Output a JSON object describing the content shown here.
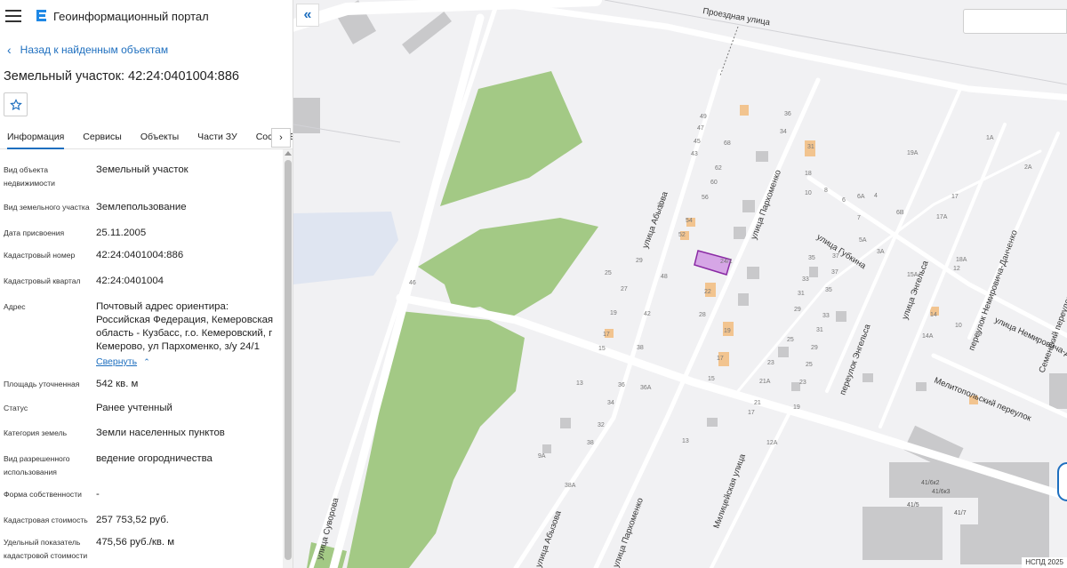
{
  "app": {
    "title": "Геоинформационный портал"
  },
  "nav": {
    "back_label": "Назад к найденным объектам"
  },
  "object": {
    "title": "Земельный участок: 42:24:0401004:886"
  },
  "tabs": [
    {
      "label": "Информация",
      "active": true
    },
    {
      "label": "Сервисы"
    },
    {
      "label": "Объекты"
    },
    {
      "label": "Части ЗУ"
    },
    {
      "label": "Состав ЕЗП"
    }
  ],
  "properties": [
    {
      "label": "Вид объекта недвижимости",
      "value": "Земельный участок"
    },
    {
      "label": "Вид земельного участка",
      "value": "Землепользование"
    },
    {
      "label": "Дата присвоения",
      "value": "25.11.2005"
    },
    {
      "label": "Кадастровый номер",
      "value": "42:24:0401004:886"
    },
    {
      "label": "Кадастровый квартал",
      "value": "42:24:0401004"
    },
    {
      "label": "Адрес",
      "value": "Почтовый адрес ориентира: Российская Федерация, Кемеровская область - Кузбасс, г.о. Кемеровский, г Кемерово, ул Пархоменко, з/у 24/1"
    },
    {
      "label": "Площадь уточненная",
      "value": "542 кв. м"
    },
    {
      "label": "Статус",
      "value": "Ранее учтенный"
    },
    {
      "label": "Категория земель",
      "value": "Земли населенных пунктов"
    },
    {
      "label": "Вид разрешенного использования",
      "value": "ведение огородничества"
    },
    {
      "label": "Форма собственности",
      "value": "-"
    },
    {
      "label": "Кадастровая стоимость",
      "value": "257 753,52 руб."
    },
    {
      "label": "Удельный показатель кадастровой стоимости",
      "value": "475,56 руб./кв. м"
    }
  ],
  "address_toggle": "Свернуть",
  "map": {
    "attribution": "НСПД 2025",
    "streets": [
      "Проездная улица",
      "улица Абызова",
      "улица Пархоменко",
      "улица Губкина",
      "улица Энгельса",
      "переулок Энгельса",
      "переулок Немировича-Данченко",
      "улица Немировича-Данченко",
      "Семенский переулок",
      "Мелитопольский переулок",
      "Милицейская улица",
      "улица Суворова",
      "улица Абызова",
      "улица Пархоменко"
    ],
    "house_numbers": [
      "49",
      "47",
      "45",
      "43",
      "36",
      "34",
      "68",
      "62",
      "60",
      "56",
      "33",
      "54",
      "52",
      "29",
      "27",
      "25",
      "19",
      "17",
      "15",
      "48",
      "42",
      "38",
      "28",
      "24/1",
      "22",
      "19",
      "17",
      "15",
      "35",
      "33",
      "31",
      "29",
      "25",
      "23",
      "21A",
      "21",
      "19",
      "17",
      "12A",
      "13",
      "11",
      "9",
      "7",
      "5",
      "3",
      "37",
      "37",
      "35",
      "33",
      "31",
      "29",
      "27",
      "25",
      "23",
      "21",
      "19",
      "17",
      "13",
      "11",
      "9",
      "7",
      "5",
      "3",
      "3A",
      "5A",
      "6A",
      "6B",
      "6",
      "8",
      "10",
      "12",
      "14",
      "16",
      "18",
      "19A",
      "17",
      "17A",
      "18A",
      "15A",
      "14",
      "14A",
      "12",
      "10",
      "8",
      "6",
      "4",
      "2",
      "13",
      "34",
      "36A",
      "36",
      "32",
      "38",
      "9A",
      "38A",
      "1A",
      "2A",
      "41/6к2",
      "41/6к3",
      "41/7",
      "41/5",
      "46",
      "31",
      "27",
      "29"
    ],
    "colors": {
      "park": "#a3c985",
      "highlight_fill": "#d6a6e6",
      "highlight_stroke": "#8a2aa4",
      "building": "#c9c9cb",
      "building_orange": "#f2c48f",
      "road": "#ffffff",
      "water": "#dfe5f1"
    }
  }
}
